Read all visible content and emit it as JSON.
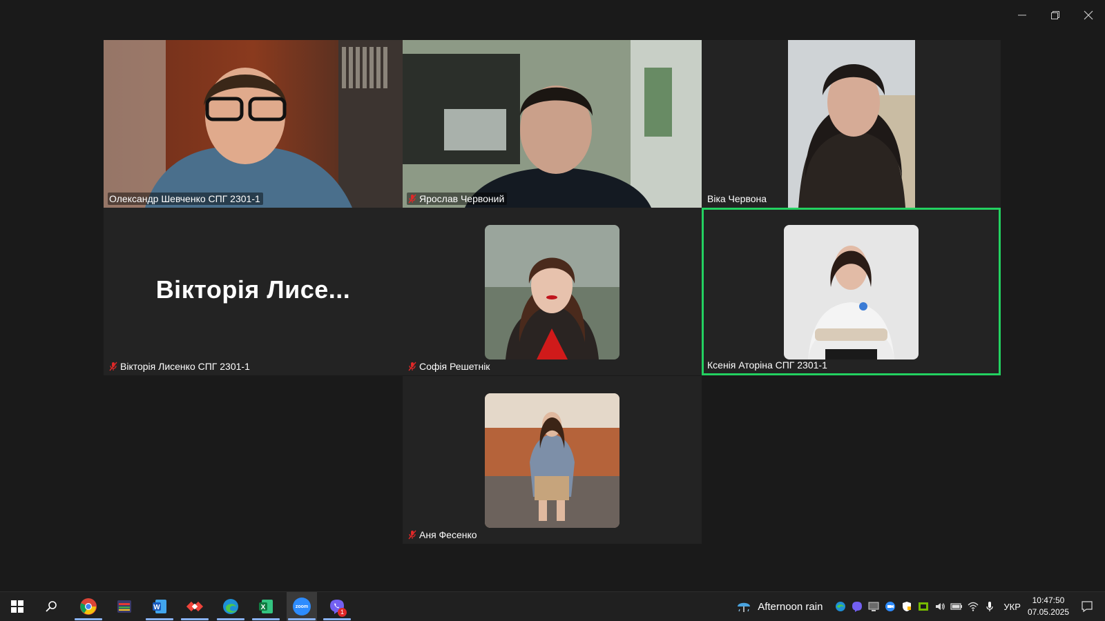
{
  "window": {
    "controls": [
      "minimize",
      "restore",
      "close"
    ]
  },
  "participants": [
    {
      "name": "Олександр Шевченко СПГ 2301-1",
      "muted": false,
      "video": true
    },
    {
      "name": "Ярослав Червоний",
      "muted": true,
      "video": true
    },
    {
      "name": "Віка Червона",
      "muted": false,
      "video": true
    },
    {
      "name": "Вікторія Лисенко СПГ 2301-1",
      "display_name": "Вікторія Лисе...",
      "muted": true,
      "video": false
    },
    {
      "name": "Софія Решетнік",
      "muted": true,
      "video": false
    },
    {
      "name": "Ксенія Аторіна СПГ 2301-1",
      "muted": false,
      "video": false,
      "active_speaker": true
    },
    {
      "name": "Аня Фесенко",
      "muted": true,
      "video": false
    }
  ],
  "colors": {
    "active_speaker_border": "#23d160",
    "muted_icon": "#e02828",
    "tile_bg": "#232323"
  },
  "taskbar": {
    "apps": [
      {
        "icon": "windows-start-icon"
      },
      {
        "icon": "search-icon"
      },
      {
        "icon": "chrome-icon",
        "running": true
      },
      {
        "icon": "app-icon"
      },
      {
        "icon": "word-icon",
        "running": true
      },
      {
        "icon": "anydesk-icon",
        "running": true
      },
      {
        "icon": "edge-icon",
        "running": true
      },
      {
        "icon": "excel-icon",
        "running": true
      },
      {
        "icon": "zoom-icon",
        "running": true,
        "label": "zoom"
      },
      {
        "icon": "viber-icon",
        "running": true,
        "badge": "1"
      }
    ],
    "weather": "Afternoon rain",
    "language": "УКР",
    "time": "10:47:50",
    "date": "07.05.2025"
  }
}
